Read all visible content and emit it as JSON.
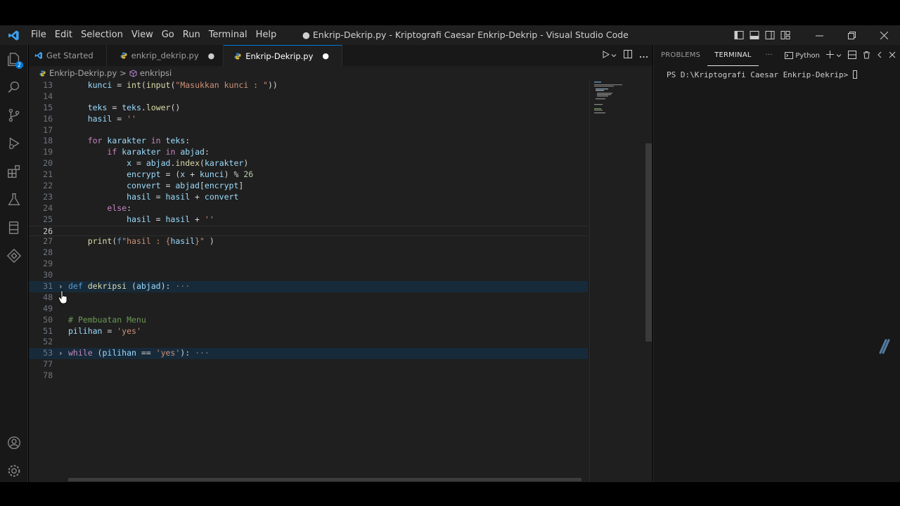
{
  "window": {
    "title": "● Enkrip-Dekrip.py - Kriptografi Caesar Enkrip-Dekrip - Visual Studio Code"
  },
  "menu": [
    "File",
    "Edit",
    "Selection",
    "View",
    "Go",
    "Run",
    "Terminal",
    "Help"
  ],
  "activity_bar": {
    "items": [
      "explorer-icon",
      "search-icon",
      "source-control-icon",
      "run-debug-icon",
      "extensions-icon",
      "testing-icon",
      "remote-explorer-icon",
      "live-share-icon"
    ],
    "explorer_badge": "2",
    "bottom": [
      "account-icon",
      "settings-gear-icon"
    ]
  },
  "tabs": [
    {
      "label": "Get Started",
      "modified": false
    },
    {
      "label": "enkrip_dekrip.py",
      "modified": true
    },
    {
      "label": "Enkrip-Dekrip.py",
      "modified": true,
      "active": true
    }
  ],
  "tab_dot": "●",
  "breadcrumb": {
    "file": "Enkrip-Dekrip.py",
    "separator": ">",
    "symbol": "enkripsi"
  },
  "code": {
    "lines": [
      {
        "n": "13",
        "indent": "    ",
        "text": "kunci = int(input(\"Masukkan kunci : \"))"
      },
      {
        "n": "14",
        "indent": "",
        "text": ""
      },
      {
        "n": "15",
        "indent": "    ",
        "text": "teks = teks.lower()"
      },
      {
        "n": "16",
        "indent": "    ",
        "text": "hasil = ''"
      },
      {
        "n": "17",
        "indent": "",
        "text": ""
      },
      {
        "n": "18",
        "indent": "    ",
        "text": "for karakter in teks:"
      },
      {
        "n": "19",
        "indent": "        ",
        "text": "if karakter in abjad:"
      },
      {
        "n": "20",
        "indent": "            ",
        "text": "x = abjad.index(karakter)"
      },
      {
        "n": "21",
        "indent": "            ",
        "text": "encrypt = (x + kunci) % 26"
      },
      {
        "n": "22",
        "indent": "            ",
        "text": "convert = abjad[encrypt]"
      },
      {
        "n": "23",
        "indent": "            ",
        "text": "hasil = hasil + convert"
      },
      {
        "n": "24",
        "indent": "        ",
        "text": "else:"
      },
      {
        "n": "25",
        "indent": "            ",
        "text": "hasil = hasil + ''"
      },
      {
        "n": "26",
        "indent": "",
        "text": ""
      },
      {
        "n": "27",
        "indent": "    ",
        "text": "print(f\"hasil : {hasil}\" )"
      },
      {
        "n": "28",
        "indent": "",
        "text": ""
      },
      {
        "n": "29",
        "indent": "",
        "text": ""
      },
      {
        "n": "30",
        "indent": "",
        "text": ""
      },
      {
        "n": "31",
        "indent": "",
        "text": "def dekripsi (abjad):",
        "folded": true,
        "fold_glyph": "›",
        "ellipsis": "···"
      },
      {
        "n": "48",
        "indent": "",
        "text": ""
      },
      {
        "n": "49",
        "indent": "",
        "text": ""
      },
      {
        "n": "50",
        "indent": "",
        "text": "# Pembuatan Menu"
      },
      {
        "n": "51",
        "indent": "",
        "text": "pilihan = 'yes'"
      },
      {
        "n": "52",
        "indent": "",
        "text": ""
      },
      {
        "n": "53",
        "indent": "",
        "text": "while (pilihan == 'yes'):",
        "folded": true,
        "fold_glyph": "›",
        "ellipsis": "···"
      },
      {
        "n": "77",
        "indent": "",
        "text": ""
      },
      {
        "n": "78",
        "indent": "",
        "text": ""
      }
    ]
  },
  "panel": {
    "tabs": [
      "PROBLEMS",
      "TERMINAL"
    ],
    "active_tab": "TERMINAL",
    "more": "···",
    "terminal_profile": "Python",
    "terminal_output": "PS D:\\Kriptografi Caesar Enkrip-Dekrip> "
  },
  "colors": {
    "accent": "#0078d4",
    "editor_bg": "#1f1f1f",
    "sidebar_bg": "#181818"
  }
}
